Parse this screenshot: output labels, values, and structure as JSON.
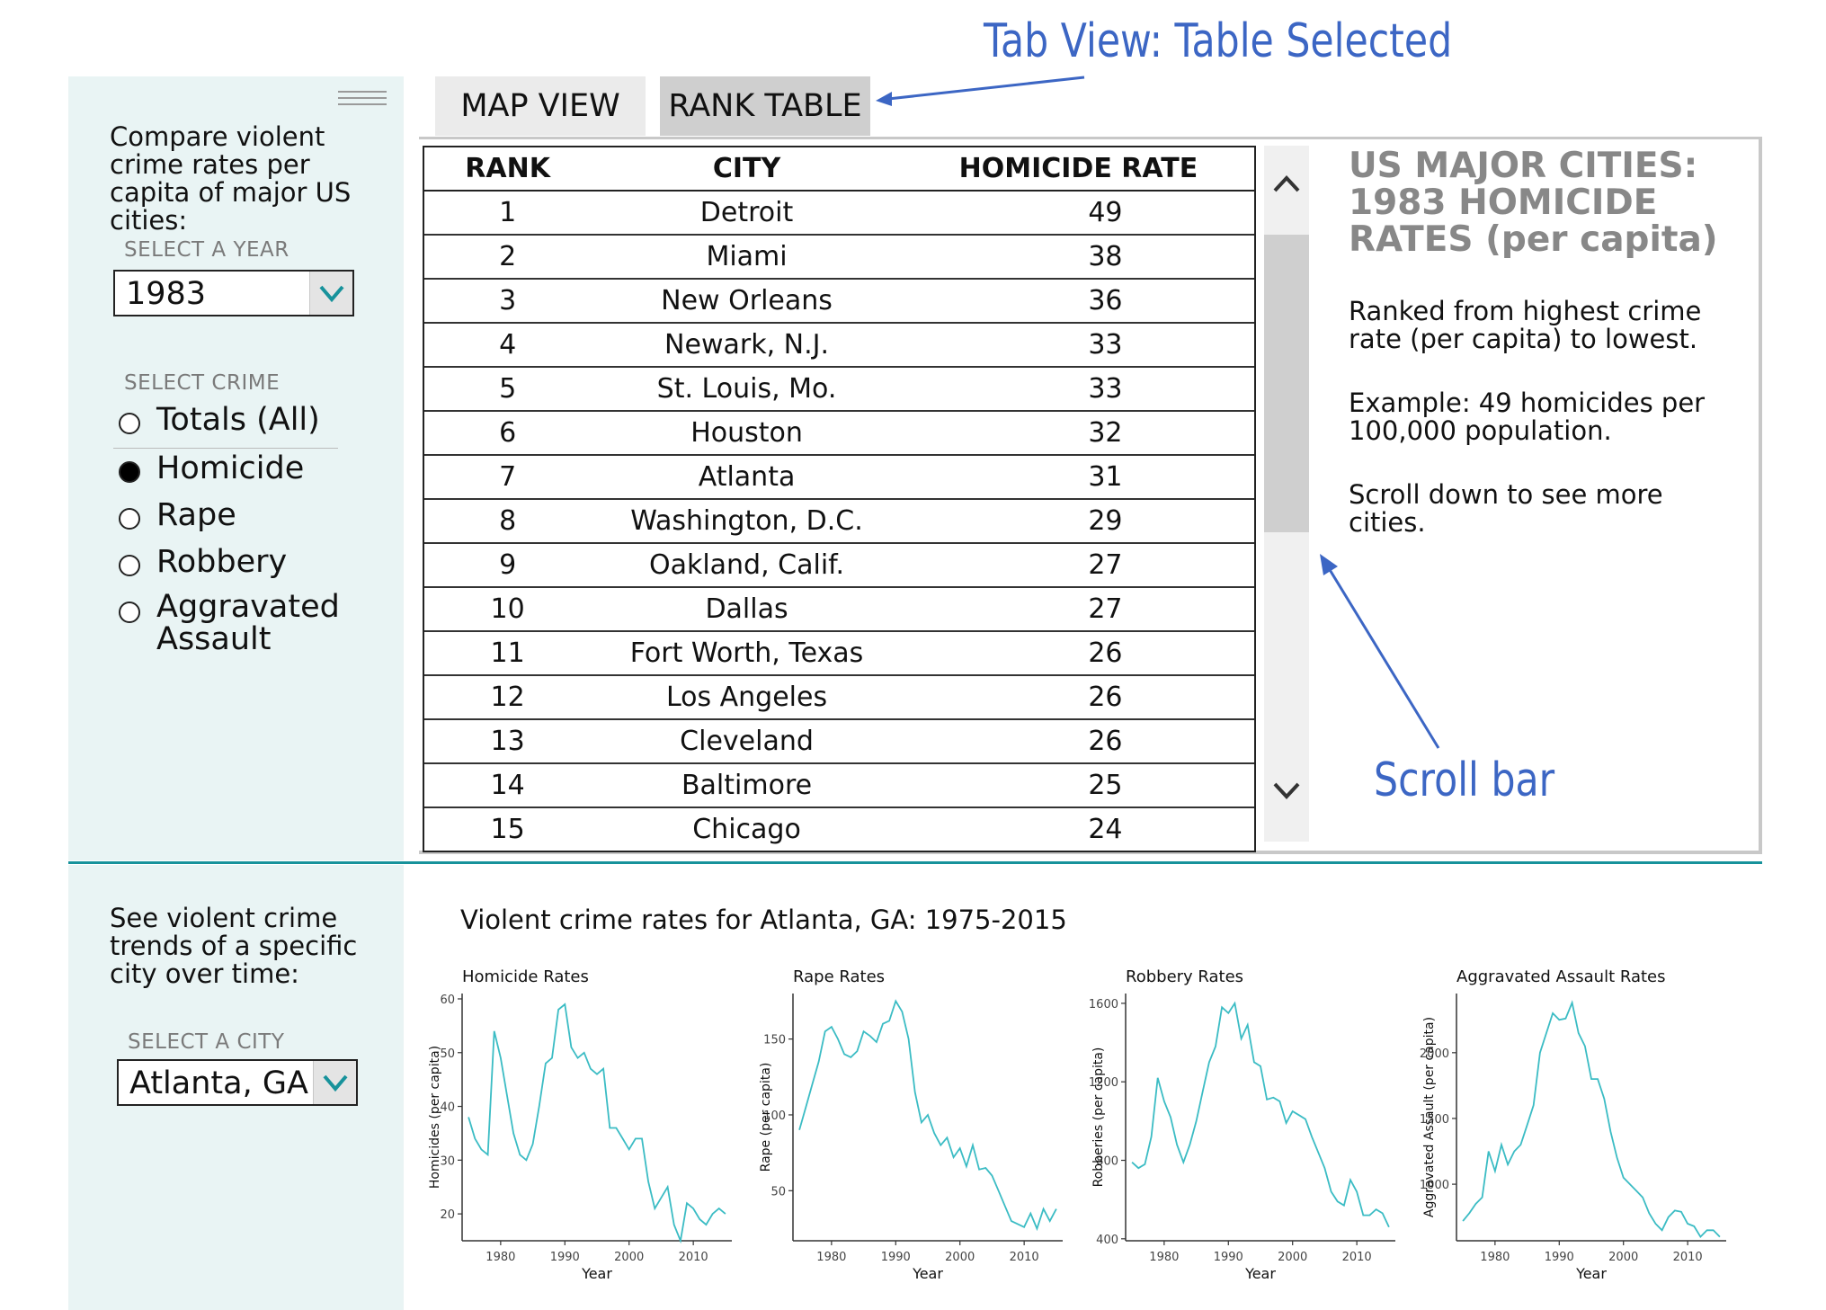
{
  "sidebar": {
    "intro": "Compare violent crime rates per capita of major US cities:",
    "year_label": "SELECT A YEAR",
    "year_value": "1983",
    "crime_label": "SELECT CRIME",
    "crimes": [
      "Totals (All)",
      "Homicide",
      "Rape",
      "Robbery",
      "Aggravated Assault"
    ],
    "selected_crime": "Homicide"
  },
  "tabs": {
    "map": "MAP VIEW",
    "rank": "RANK TABLE"
  },
  "table": {
    "headers": [
      "RANK",
      "CITY",
      "HOMICIDE RATE"
    ],
    "rows": [
      [
        "1",
        "Detroit",
        "49"
      ],
      [
        "2",
        "Miami",
        "38"
      ],
      [
        "3",
        "New Orleans",
        "36"
      ],
      [
        "4",
        "Newark, N.J.",
        "33"
      ],
      [
        "5",
        "St. Louis, Mo.",
        "33"
      ],
      [
        "6",
        "Houston",
        "32"
      ],
      [
        "7",
        "Atlanta",
        "31"
      ],
      [
        "8",
        "Washington, D.C.",
        "29"
      ],
      [
        "9",
        "Oakland, Calif.",
        "27"
      ],
      [
        "10",
        "Dallas",
        "27"
      ],
      [
        "11",
        "Fort Worth, Texas",
        "26"
      ],
      [
        "12",
        "Los Angeles",
        "26"
      ],
      [
        "13",
        "Cleveland",
        "26"
      ],
      [
        "14",
        "Baltimore",
        "25"
      ],
      [
        "15",
        "Chicago",
        "24"
      ]
    ]
  },
  "info": {
    "title": "US MAJOR CITIES: 1983 HOMICIDE RATES (per capita)",
    "p1": "Ranked from highest crime rate (per capita) to lowest.",
    "p2": "Example: 49 homicides per 100,000 population.",
    "p3": "Scroll down to see more cities."
  },
  "annotations": {
    "tab_note": "Tab View: Table Selected",
    "scroll_note": "Scroll bar"
  },
  "trend": {
    "intro": "See violent crime trends of a specific city over time:",
    "city_label": "SELECT A CITY",
    "city_value": "Atlanta, GA",
    "title": "Violent crime rates for Atlanta, GA: 1975-2015"
  },
  "colors": {
    "accent": "#17929b",
    "sidebar_bg": "#e9f4f4",
    "annotation": "#3c66c4",
    "line": "#3bbcc4"
  },
  "chart_data": [
    {
      "type": "line",
      "title": "Homicide Rates",
      "xlabel": "Year",
      "ylabel": "Homicides (per capita)",
      "xlim": [
        1974,
        2016
      ],
      "ylim": [
        15,
        61
      ],
      "xticks": [
        1980,
        1990,
        2000,
        2010
      ],
      "yticks": [
        20,
        30,
        40,
        50,
        60
      ],
      "x": [
        1975,
        1976,
        1977,
        1978,
        1979,
        1980,
        1981,
        1982,
        1983,
        1984,
        1985,
        1986,
        1987,
        1988,
        1989,
        1990,
        1991,
        1992,
        1993,
        1994,
        1995,
        1996,
        1997,
        1998,
        1999,
        2000,
        2001,
        2002,
        2003,
        2004,
        2005,
        2006,
        2007,
        2008,
        2009,
        2010,
        2011,
        2012,
        2013,
        2014,
        2015
      ],
      "y": [
        38,
        34,
        32,
        31,
        54,
        49,
        42,
        35,
        31,
        30,
        33,
        40,
        48,
        49,
        58,
        59,
        51,
        49,
        50,
        47,
        46,
        47,
        36,
        36,
        34,
        32,
        34,
        34,
        26,
        21,
        23,
        25,
        18,
        15,
        22,
        21,
        19,
        18,
        20,
        21,
        20
      ]
    },
    {
      "type": "line",
      "title": "Rape Rates",
      "xlabel": "Year",
      "ylabel": "Rape (per capita)",
      "xlim": [
        1974,
        2016
      ],
      "ylim": [
        17,
        180
      ],
      "xticks": [
        1980,
        1990,
        2000,
        2010
      ],
      "yticks": [
        50,
        100,
        150
      ],
      "x": [
        1975,
        1976,
        1977,
        1978,
        1979,
        1980,
        1981,
        1982,
        1983,
        1984,
        1985,
        1986,
        1987,
        1988,
        1989,
        1990,
        1991,
        1992,
        1993,
        1994,
        1995,
        1996,
        1997,
        1998,
        1999,
        2000,
        2001,
        2002,
        2003,
        2004,
        2005,
        2006,
        2007,
        2008,
        2009,
        2010,
        2011,
        2012,
        2013,
        2014,
        2015
      ],
      "y": [
        90,
        105,
        120,
        135,
        155,
        158,
        150,
        140,
        138,
        142,
        155,
        152,
        148,
        160,
        162,
        175,
        168,
        150,
        115,
        95,
        100,
        88,
        80,
        85,
        72,
        78,
        66,
        80,
        64,
        65,
        60,
        50,
        40,
        30,
        28,
        26,
        35,
        25,
        38,
        30,
        38
      ]
    },
    {
      "type": "line",
      "title": "Robbery Rates",
      "xlabel": "Year",
      "ylabel": "Robberies (per capita)",
      "xlim": [
        1974,
        2016
      ],
      "ylim": [
        390,
        1650
      ],
      "xticks": [
        1980,
        1990,
        2000,
        2010
      ],
      "yticks": [
        400,
        800,
        1200,
        1600
      ],
      "x": [
        1975,
        1976,
        1977,
        1978,
        1979,
        1980,
        1981,
        1982,
        1983,
        1984,
        1985,
        1986,
        1987,
        1988,
        1989,
        1990,
        1991,
        1992,
        1993,
        1994,
        1995,
        1996,
        1997,
        1998,
        1999,
        2000,
        2001,
        2002,
        2003,
        2004,
        2005,
        2006,
        2007,
        2008,
        2009,
        2010,
        2011,
        2012,
        2013,
        2014,
        2015
      ],
      "y": [
        790,
        760,
        780,
        920,
        1220,
        1100,
        1020,
        880,
        790,
        880,
        1000,
        1150,
        1300,
        1380,
        1580,
        1550,
        1600,
        1420,
        1490,
        1300,
        1280,
        1110,
        1120,
        1100,
        990,
        1050,
        1030,
        1010,
        920,
        840,
        760,
        640,
        590,
        570,
        700,
        640,
        520,
        520,
        550,
        530,
        460
      ]
    },
    {
      "type": "line",
      "title": "Aggravated Assault Rates",
      "xlabel": "Year",
      "ylabel": "Aggravated Assault (per capita)",
      "xlim": [
        1974,
        2016
      ],
      "ylim": [
        570,
        2450
      ],
      "xticks": [
        1980,
        1990,
        2000,
        2010
      ],
      "yticks": [
        1000,
        1500,
        2000
      ],
      "x": [
        1975,
        1976,
        1977,
        1978,
        1979,
        1980,
        1981,
        1982,
        1983,
        1984,
        1985,
        1986,
        1987,
        1988,
        1989,
        1990,
        1991,
        1992,
        1993,
        1994,
        1995,
        1996,
        1997,
        1998,
        1999,
        2000,
        2001,
        2002,
        2003,
        2004,
        2005,
        2006,
        2007,
        2008,
        2009,
        2010,
        2011,
        2012,
        2013,
        2014,
        2015
      ],
      "y": [
        720,
        780,
        850,
        900,
        1250,
        1100,
        1300,
        1150,
        1250,
        1300,
        1450,
        1600,
        2000,
        2150,
        2300,
        2250,
        2260,
        2380,
        2150,
        2050,
        1800,
        1800,
        1650,
        1400,
        1200,
        1050,
        1000,
        950,
        900,
        780,
        700,
        650,
        750,
        800,
        790,
        700,
        680,
        600,
        650,
        650,
        600
      ]
    }
  ]
}
